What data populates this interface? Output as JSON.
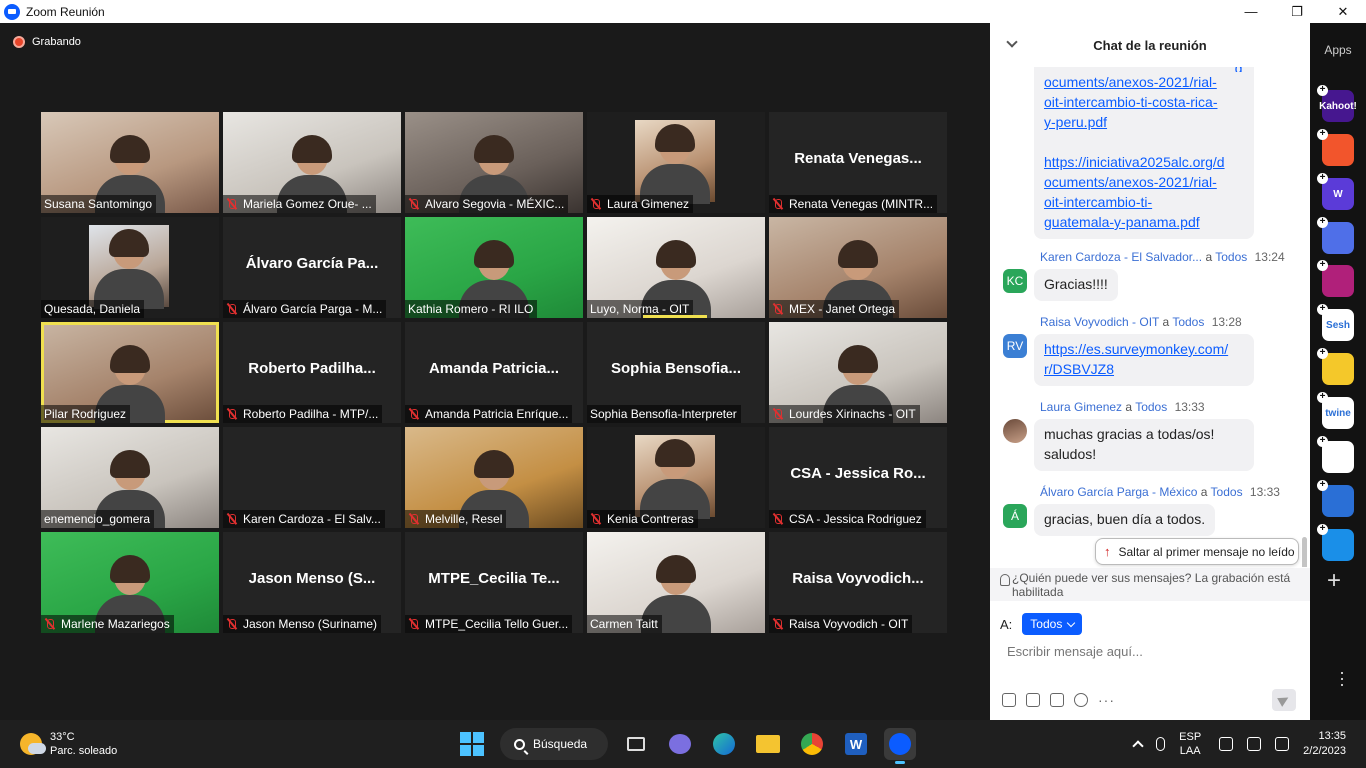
{
  "window": {
    "title": "Zoom Reunión",
    "minimize": "—",
    "maximize": "❐",
    "close": "✕"
  },
  "recording_label": "Grabando",
  "tiles": [
    {
      "id": "t0",
      "name": "Susana Santomingo",
      "muted": false,
      "video": "warm"
    },
    {
      "id": "t1",
      "name": "Mariela Gomez Orue- ...",
      "muted": true,
      "video": "white"
    },
    {
      "id": "t2",
      "name": "Alvaro Segovia - MÉXIC...",
      "muted": true,
      "video": "grey"
    },
    {
      "id": "t3",
      "name": "Laura Gimenez",
      "muted": true,
      "video": "portrait"
    },
    {
      "id": "t4",
      "name": "Renata Venegas (MINTR...",
      "muted": true,
      "big": "Renata  Venegas..."
    },
    {
      "id": "t5",
      "name": "Quesada, Daniela",
      "muted": false,
      "video": "portrait-blue"
    },
    {
      "id": "t6",
      "name": "Álvaro García Parga - M...",
      "muted": true,
      "big": "Álvaro  García  Pa..."
    },
    {
      "id": "t7",
      "name": "Kathia Romero - RI ILO",
      "muted": false,
      "video": "green"
    },
    {
      "id": "t8",
      "name": "Luyo, Norma - OIT",
      "muted": false,
      "video": "bright",
      "active": true
    },
    {
      "id": "t9",
      "name": "MEX - Janet Ortega",
      "muted": true,
      "video": "room"
    },
    {
      "id": "t10",
      "name": "Pilar Rodriguez",
      "muted": false,
      "video": "room",
      "selected": true
    },
    {
      "id": "t11",
      "name": "Roberto Padilha - MTP/...",
      "muted": true,
      "big": "Roberto  Padilha..."
    },
    {
      "id": "t12",
      "name": "Amanda Patricia Enríque...",
      "muted": true,
      "big": "Amanda  Patricia..."
    },
    {
      "id": "t13",
      "name": "Sophia Bensofia-Interpreter",
      "muted": false,
      "big": "Sophia  Bensofia..."
    },
    {
      "id": "t14",
      "name": "Lourdes Xirinachs - OIT",
      "muted": true,
      "video": "white"
    },
    {
      "id": "t15",
      "name": "enemencio_gomera",
      "muted": false,
      "video": "white"
    },
    {
      "id": "t16",
      "name": "Karen Cardoza - El Salv...",
      "muted": true,
      "big": ""
    },
    {
      "id": "t17",
      "name": "Melville, Resel",
      "muted": true,
      "video": "yellow"
    },
    {
      "id": "t18",
      "name": "Kenia Contreras",
      "muted": true,
      "video": "portrait"
    },
    {
      "id": "t19",
      "name": "CSA - Jessica Rodriguez",
      "muted": true,
      "big": "CSA  -  Jessica  Ro..."
    },
    {
      "id": "t20",
      "name": "Marlene Mazariegos",
      "muted": true,
      "video": "green"
    },
    {
      "id": "t21",
      "name": "Jason Menso (Suriname)",
      "muted": true,
      "big": "Jason  Menso  (S..."
    },
    {
      "id": "t22",
      "name": "MTPE_Cecilia Tello Guer...",
      "muted": true,
      "big": "MTPE_Cecilia  Te..."
    },
    {
      "id": "t23",
      "name": "Carmen Taitt",
      "muted": false,
      "video": "bright"
    },
    {
      "id": "t24",
      "name": "Raisa Voyvodich - OIT",
      "muted": true,
      "big": "Raisa  Voyvodich..."
    }
  ],
  "chat": {
    "title": "Chat de la reunión",
    "partial_link_lines": [
      "ocuments/anexos-2021/rial-",
      "oit-intercambio-ti-costa-rica-",
      "y-peru.pdf"
    ],
    "link2_lines": [
      "https://iniciativa2025alc.org/d",
      "ocuments/anexos-2021/rial-",
      "oit-intercambio-ti-",
      "guatemala-y-panama.pdf"
    ],
    "messages": [
      {
        "sender": "Karen Cardoza - El Salvador...",
        "to_word": "a",
        "to": "Todos",
        "time": "13:24",
        "avatar": "KC",
        "text": "Gracias!!!!"
      },
      {
        "sender": "Raisa Voyvodich - OIT",
        "to_word": "a",
        "to": "Todos",
        "time": "13:28",
        "avatar": "RV",
        "link_lines": [
          "https://es.surveymonkey.com/",
          "r/DSBVJZ8"
        ]
      },
      {
        "sender": "Laura Gimenez",
        "to_word": "a",
        "to": "Todos",
        "time": "13:33",
        "avatar": "",
        "lines": [
          "muchas gracias a todas/os!",
          "saludos!"
        ]
      },
      {
        "sender": "Álvaro García Parga - México",
        "to_word": "a",
        "to": "Todos",
        "time": "13:33",
        "avatar": "Á",
        "text": "gracias, buen día a todos."
      }
    ],
    "jump_button": "Saltar al primer mensaje no leído",
    "privacy_note": "¿Quién puede ver sus mensajes? La grabación está habilitada",
    "to_label": "A:",
    "to_value": "Todos",
    "input_placeholder": "Escribir mensaje aquí..."
  },
  "apps_rail": {
    "label": "Apps",
    "apps": [
      {
        "name": "Kahoot!",
        "color": "#46178f",
        "text": "Kahoot!"
      },
      {
        "name": "app-orange",
        "color": "#f2552c",
        "text": ""
      },
      {
        "name": "app-w",
        "color": "#5b3bd8",
        "text": "W"
      },
      {
        "name": "app-blue-circle",
        "color": "#4f6fe8",
        "text": ""
      },
      {
        "name": "app-pink",
        "color": "#b0207a",
        "text": ""
      },
      {
        "name": "Sesh",
        "color": "#ffffff",
        "text": "Sesh"
      },
      {
        "name": "app-yellow",
        "color": "#f4c82a",
        "text": ""
      },
      {
        "name": "twine",
        "color": "#ffffff",
        "text": "twine"
      },
      {
        "name": "app-colorful",
        "color": "#ffffff",
        "text": ""
      },
      {
        "name": "app-sync",
        "color": "#2a6fd6",
        "text": ""
      },
      {
        "name": "app-cyan",
        "color": "#1a8fe8",
        "text": ""
      }
    ]
  },
  "taskbar": {
    "temperature": "33°C",
    "weather": "Parc. soleado",
    "search_label": "Búsqueda",
    "lang_1": "ESP",
    "lang_2": "LAA",
    "time": "13:35",
    "date": "2/2/2023"
  }
}
